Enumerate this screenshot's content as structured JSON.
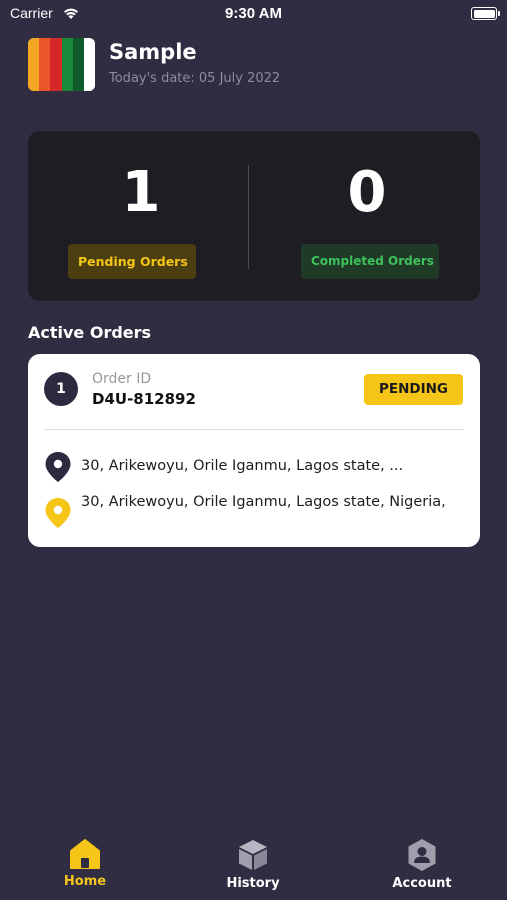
{
  "status_bar": {
    "carrier": "Carrier",
    "time": "9:30 AM"
  },
  "header": {
    "store_name": "Sample",
    "date_text": "Today's date: 05 July 2022",
    "logo_colors": [
      "#f5a623",
      "#e8562a",
      "#d62828",
      "#1a8a3a",
      "#0f5c2a",
      "#ffffff"
    ]
  },
  "stats": {
    "pending_count": "1",
    "pending_label": "Pending Orders",
    "completed_count": "0",
    "completed_label": "Completed Orders"
  },
  "active_orders": {
    "title": "Active Orders",
    "orders": [
      {
        "index": "1",
        "id_label": "Order ID",
        "id_value": "D4U-812892",
        "status": "PENDING",
        "pickup_address": "30, Arikewoyu, Orile Iganmu, Lagos state, ...",
        "dropoff_address": "30, Arikewoyu, Orile Iganmu, Lagos state, Nigeria,"
      }
    ]
  },
  "nav": {
    "items": [
      {
        "label": "Home",
        "icon": "home-icon",
        "active": true
      },
      {
        "label": "History",
        "icon": "box-icon",
        "active": false
      },
      {
        "label": "Account",
        "icon": "account-icon",
        "active": false
      }
    ]
  },
  "colors": {
    "background": "#302c42",
    "card_dark": "#1e1d23",
    "accent_yellow": "#f5c518",
    "accent_green": "#3fc05a"
  }
}
